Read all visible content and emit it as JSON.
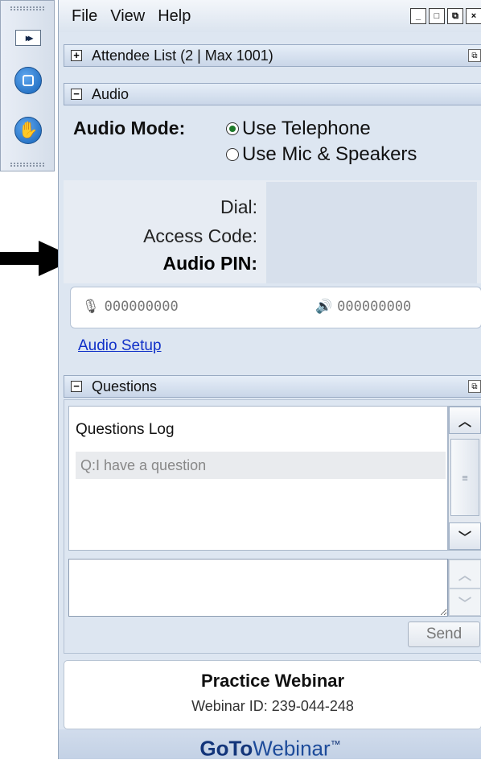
{
  "strip": {
    "expand_glyph": "▸▸"
  },
  "menu": {
    "items": [
      "File",
      "View",
      "Help"
    ],
    "window_buttons": [
      "_",
      "□",
      "⧉",
      "×"
    ]
  },
  "attendee": {
    "toggle": "+",
    "label": "Attendee List   (2 | Max 1001)"
  },
  "audio": {
    "toggle": "−",
    "header": "Audio",
    "mode_label": "Audio Mode:",
    "options": [
      {
        "label": "Use Telephone",
        "selected": true
      },
      {
        "label": "Use Mic & Speakers",
        "selected": false
      }
    ],
    "dial_label": "Dial:",
    "access_code_label": "Access Code:",
    "audio_pin_label": "Audio PIN:",
    "mic_level": "000000000",
    "speaker_level": "000000000",
    "setup_link": "Audio Setup"
  },
  "questions": {
    "toggle": "−",
    "header": "Questions",
    "log_title": "Questions Log",
    "items": [
      "Q:I have a question"
    ],
    "input_value": "",
    "send_label": "Send"
  },
  "webinar": {
    "title": "Practice Webinar",
    "id_line": "Webinar ID: 239-044-248"
  },
  "brand": {
    "bold": "GoTo",
    "light": "Webinar",
    "tm": "™"
  },
  "colors": {
    "panel_bg": "#dde6f1",
    "link": "#1030c8",
    "brand": "#13357a"
  }
}
